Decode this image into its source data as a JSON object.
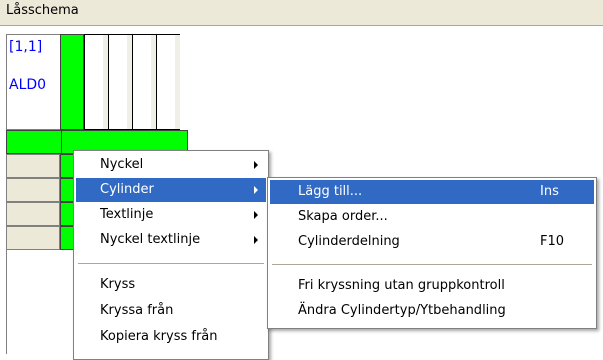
{
  "window": {
    "title": "Låsschema"
  },
  "grid": {
    "ref_label": "[1,1]",
    "row_label": "ALD0"
  },
  "context_menu": {
    "items": [
      {
        "label": "Nyckel",
        "submenu": true
      },
      {
        "label": "Cylinder",
        "submenu": true,
        "selected": true
      },
      {
        "label": "Textlinje",
        "submenu": true
      },
      {
        "label": "Nyckel textlinje",
        "submenu": true
      },
      {
        "label": "Kryss"
      },
      {
        "label": "Kryssa från"
      },
      {
        "label": "Kopiera kryss från"
      }
    ]
  },
  "submenu": {
    "items": [
      {
        "label": "Lägg till...",
        "shortcut": "Ins",
        "selected": true
      },
      {
        "label": "Skapa order..."
      },
      {
        "label": "Cylinderdelning",
        "shortcut": "F10"
      },
      {
        "label": "Fri kryssning utan gruppkontroll"
      },
      {
        "label": "Ändra Cylindertyp/Ytbehandling"
      }
    ]
  },
  "colors": {
    "highlight": "#316ac5",
    "grid_green": "#00ff00",
    "link_blue": "#0000ff"
  }
}
